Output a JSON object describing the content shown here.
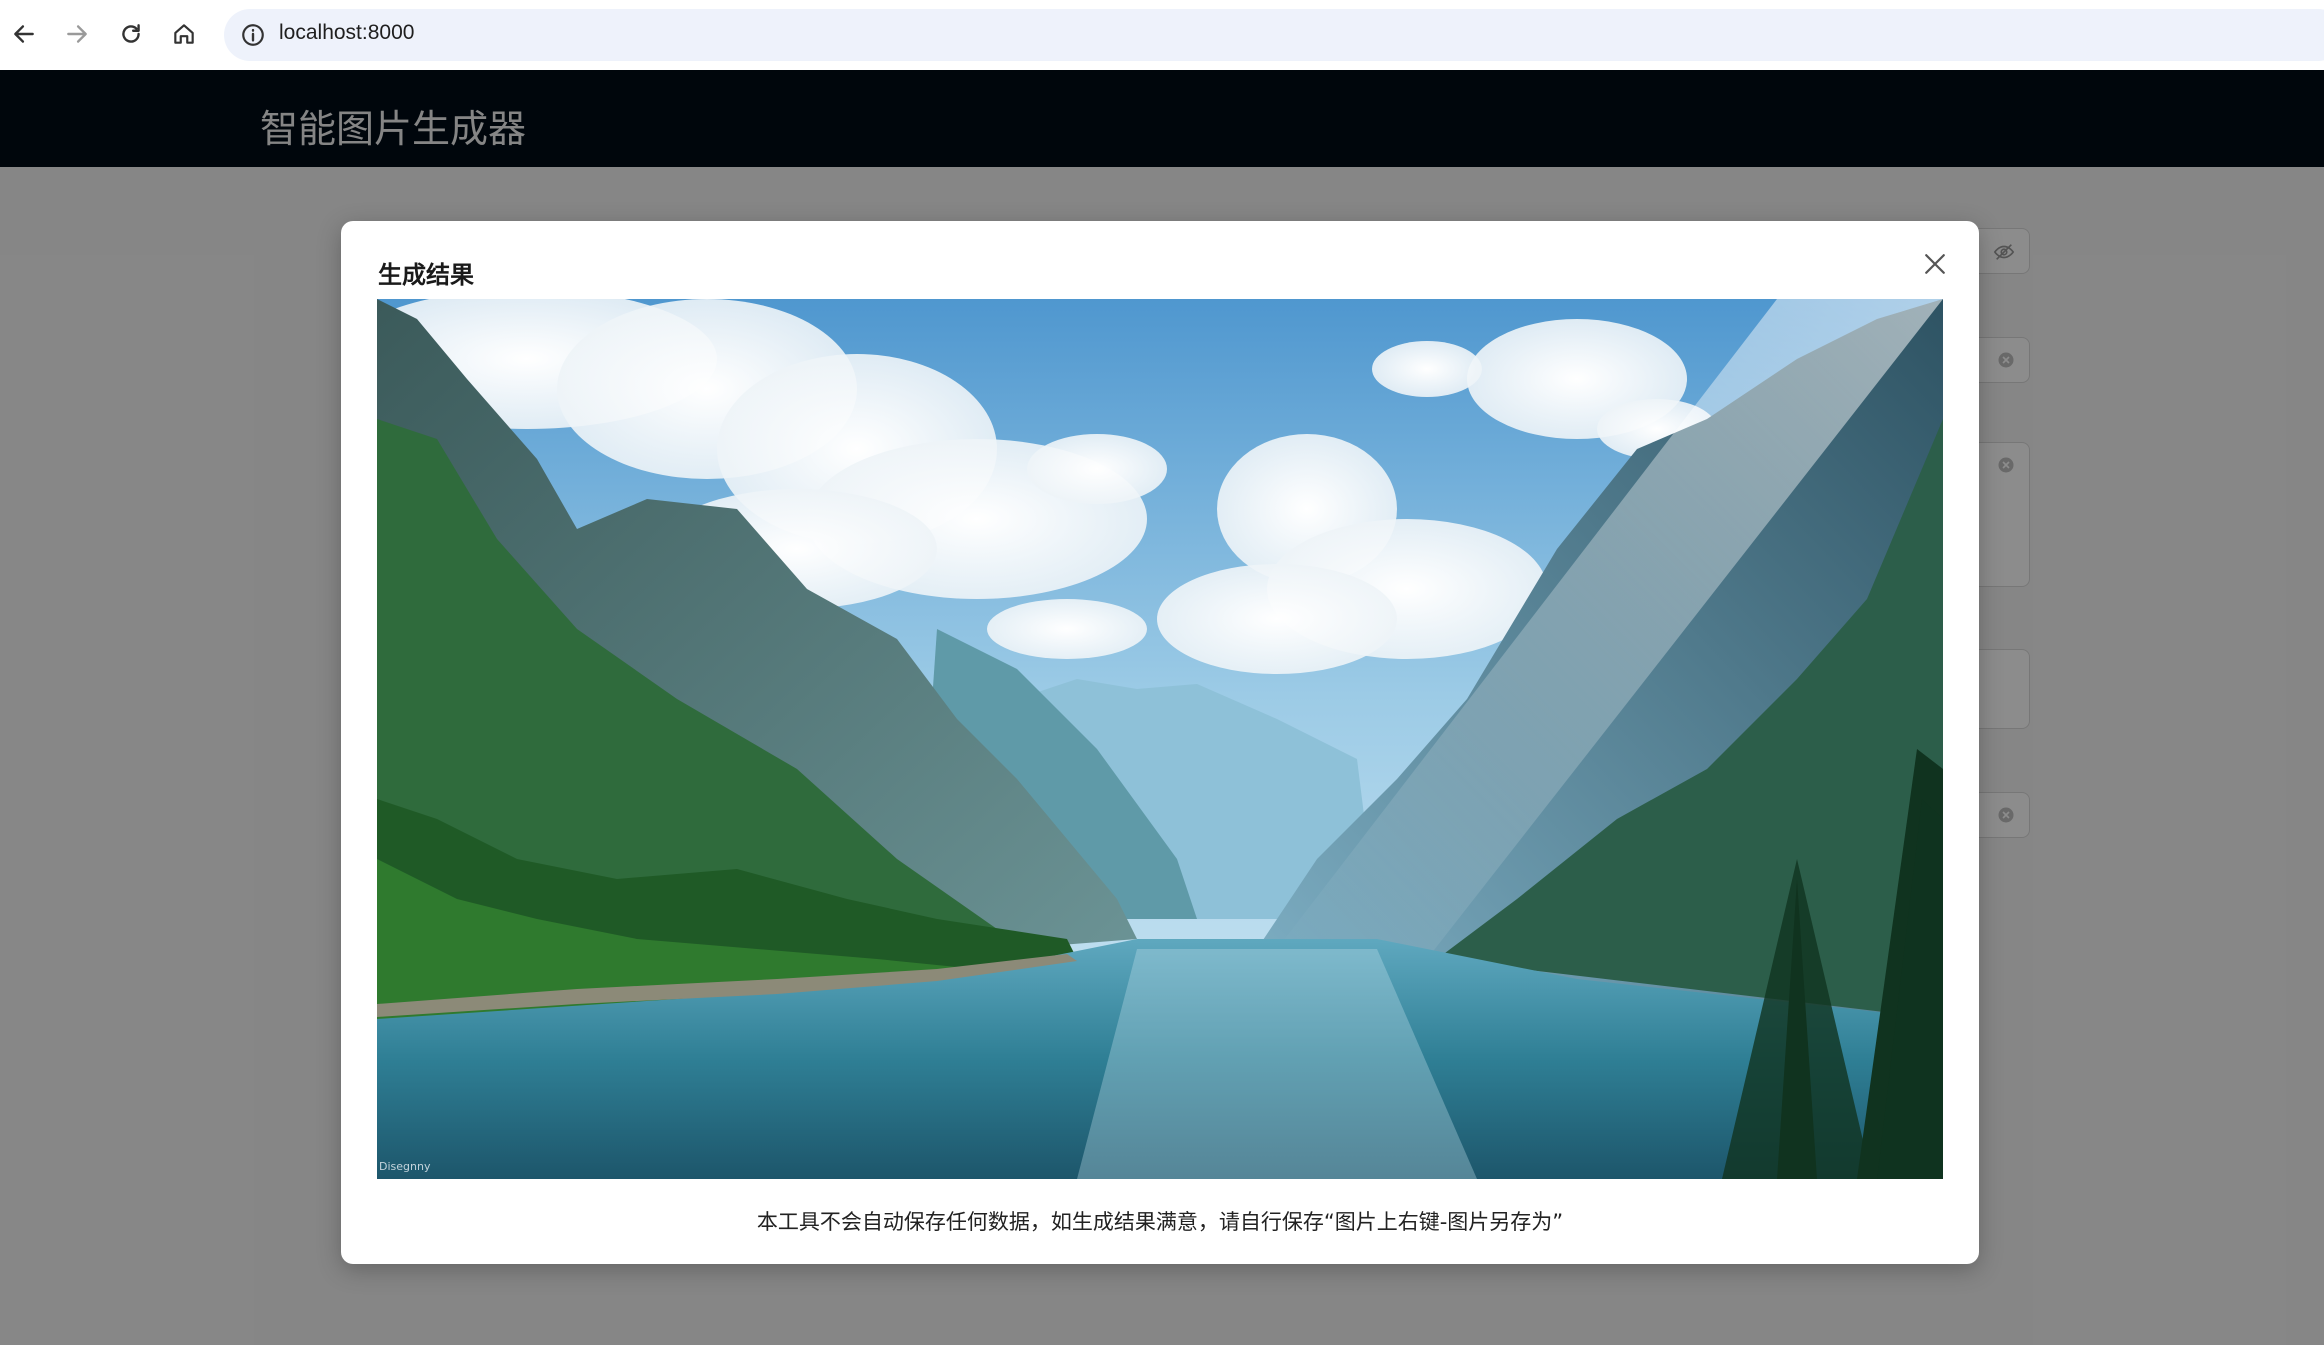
{
  "browser": {
    "url": "localhost:8000",
    "icons": [
      "back-arrow-icon",
      "forward-arrow-icon",
      "reload-icon",
      "home-icon",
      "site-info-icon"
    ]
  },
  "app": {
    "title": "智能图片生成器"
  },
  "modal": {
    "title": "生成结果",
    "image_watermark": "Disegnny",
    "note": "本工具不会自动保存任何数据，如生成结果满意，请自行保存“图片上右键-图片另存为”"
  },
  "colors": {
    "header_bg": "#000c17",
    "mask": "rgba(0,0,0,0.45)",
    "address_bar": "#eef2fb"
  }
}
